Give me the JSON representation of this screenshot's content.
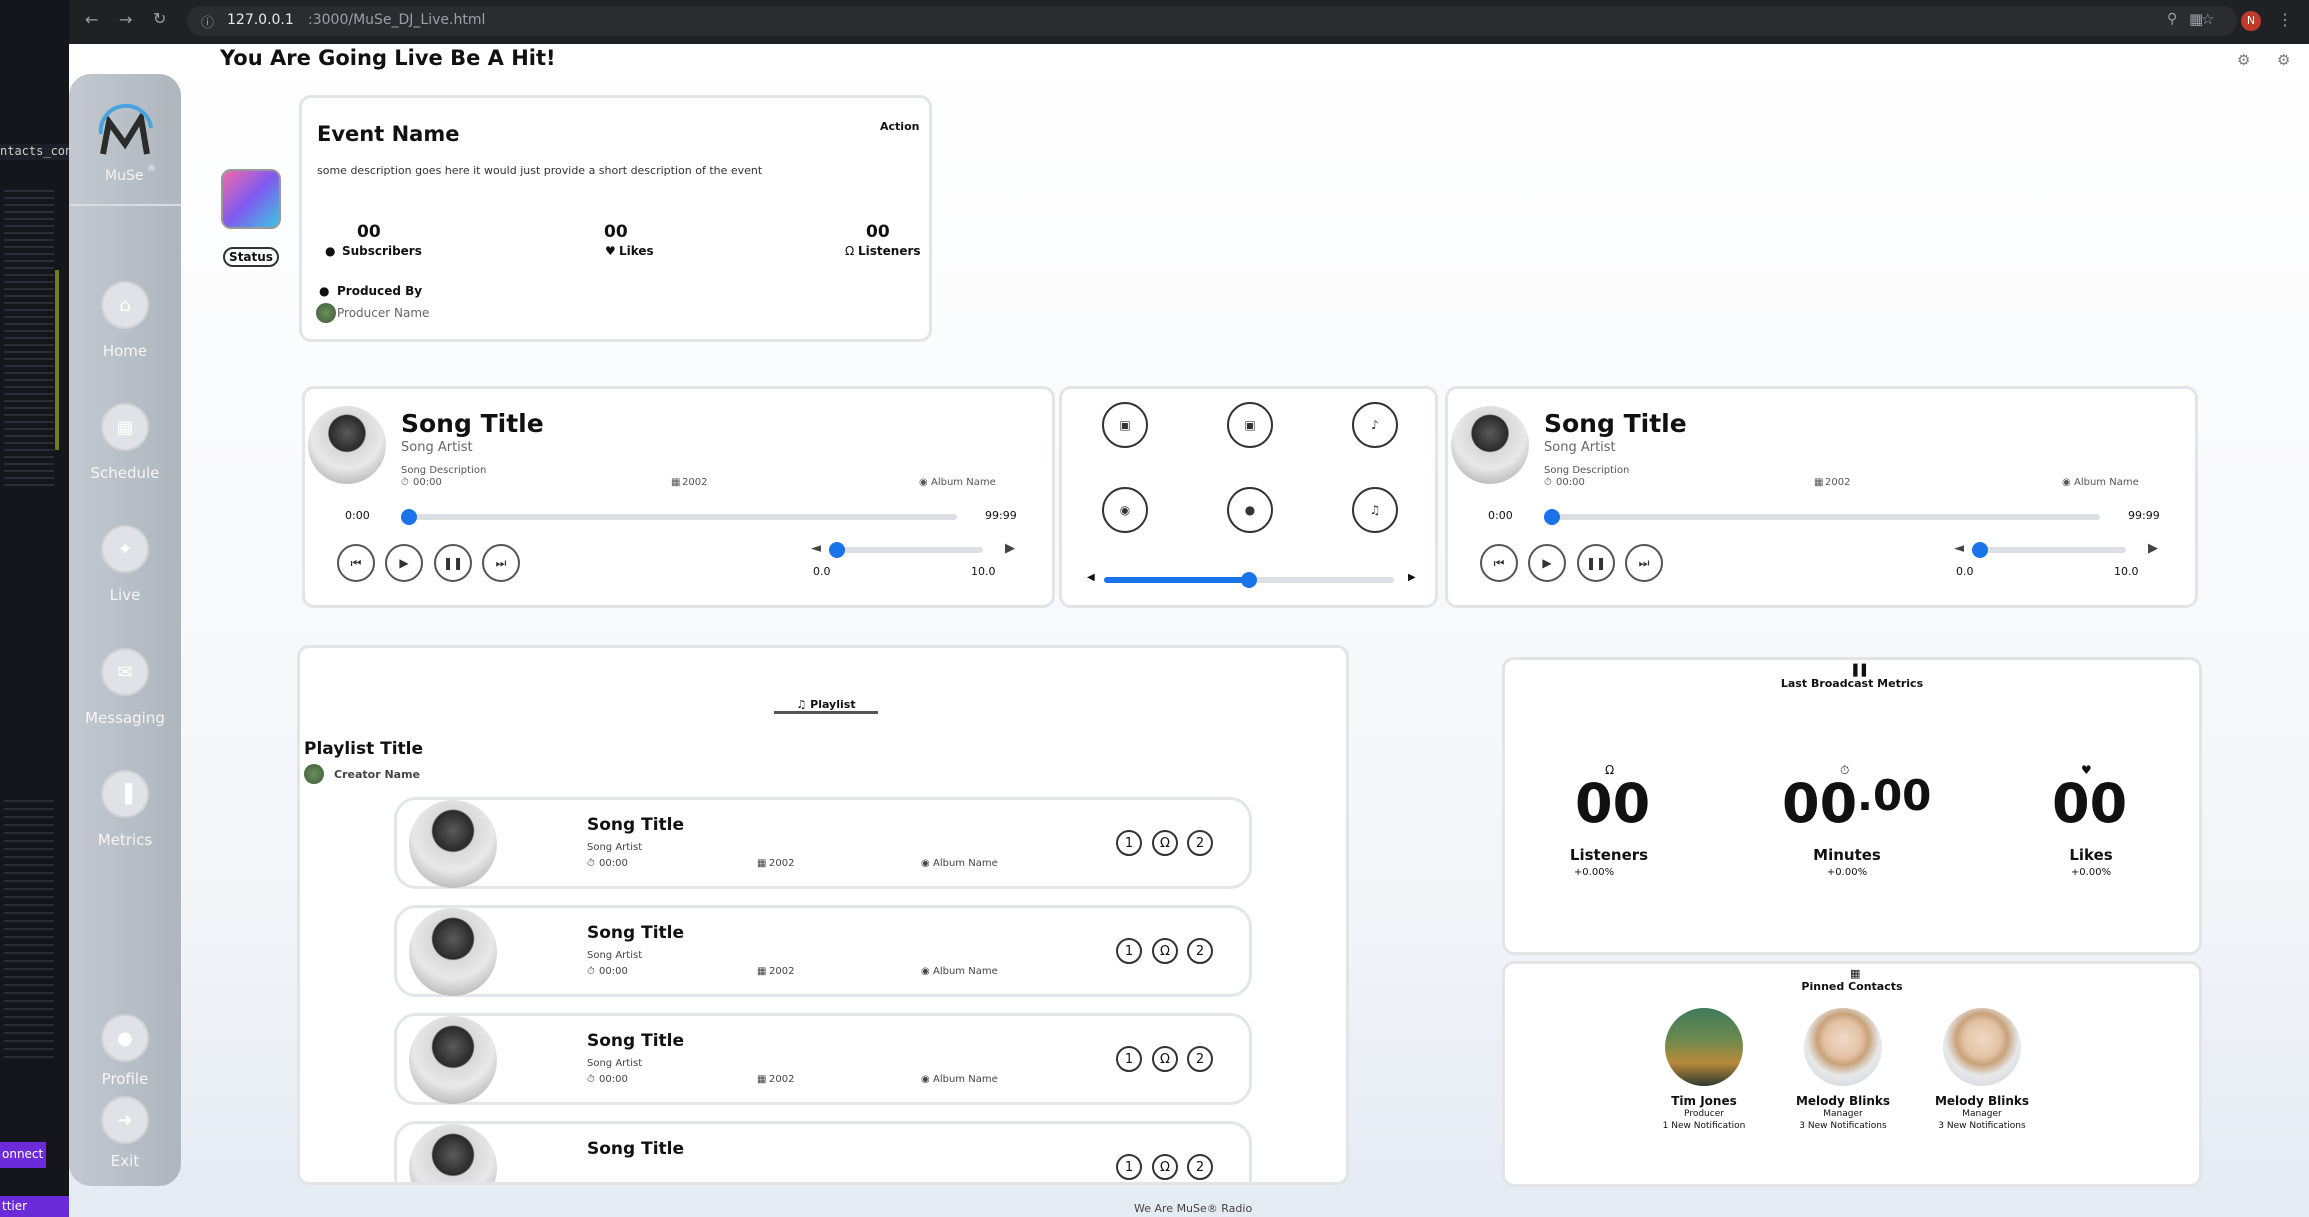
{
  "browser": {
    "url_host": "127.0.0.1",
    "url_path": ":3000/MuSe_DJ_Live.html",
    "profile_initial": "N"
  },
  "left_strip": {
    "file_label": "ntacts_con",
    "connect_label": "onnect",
    "bottom_label": "ttier"
  },
  "colors": {
    "accent": "#1a73e8",
    "sidebar": "#b9c0c8",
    "connect": "#6c2bd9"
  },
  "sidebar": {
    "logo_text": "MuSe",
    "logo_mark": "®",
    "items": [
      {
        "label": "Home",
        "icon": "home-icon"
      },
      {
        "label": "Schedule",
        "icon": "calendar-icon"
      },
      {
        "label": "Live",
        "icon": "broadcast-icon"
      },
      {
        "label": "Messaging",
        "icon": "inbox-icon"
      },
      {
        "label": "Metrics",
        "icon": "bar-chart-icon"
      }
    ],
    "profile_label": "Profile",
    "exit_label": "Exit"
  },
  "header": {
    "title": "You Are Going Live Be A Hit!"
  },
  "event": {
    "name": "Event Name",
    "action": "Action",
    "description": "some description goes here it would just provide a short description of the event",
    "status": "Status",
    "stats": [
      {
        "value": "00",
        "label": "Subscribers",
        "icon": "users-icon"
      },
      {
        "value": "00",
        "label": "Likes",
        "icon": "heart-icon"
      },
      {
        "value": "00",
        "label": "Listeners",
        "icon": "headphones-icon"
      }
    ],
    "produced_by": "Produced By",
    "producer": "Producer Name"
  },
  "players": [
    {
      "title": "Song Title",
      "artist": "Song Artist",
      "description": "Song Description",
      "duration": "00:00",
      "year": "2002",
      "album": "Album Name",
      "time_start": "0:00",
      "time_end": "99:99",
      "progress": 0,
      "vol_min": "0.0",
      "vol_max": "10.0",
      "volume": 0
    },
    {
      "title": "Song Title",
      "artist": "Song Artist",
      "description": "Song Description",
      "duration": "00:00",
      "year": "2002",
      "album": "Album Name",
      "time_start": "0:00",
      "time_end": "99:99",
      "progress": 0,
      "vol_min": "0.0",
      "vol_max": "10.0",
      "volume": 0
    }
  ],
  "mixer": {
    "pads": [
      "drum-icon",
      "drum-icon",
      "guitar-icon",
      "cymbal-icon",
      "record-icon",
      "microphone-icon"
    ],
    "crossfader": 0.5
  },
  "playlist": {
    "tab_label": "Playlist",
    "title": "Playlist Title",
    "creator": "Creator Name",
    "songs": [
      {
        "title": "Song Title",
        "artist": "Song Artist",
        "duration": "00:00",
        "year": "2002",
        "album": "Album Name"
      },
      {
        "title": "Song Title",
        "artist": "Song Artist",
        "duration": "00:00",
        "year": "2002",
        "album": "Album Name"
      },
      {
        "title": "Song Title",
        "artist": "Song Artist",
        "duration": "00:00",
        "year": "2002",
        "album": "Album Name"
      },
      {
        "title": "Song Title",
        "artist": "",
        "duration": "",
        "year": "",
        "album": ""
      }
    ],
    "row_buttons": [
      "1",
      "2"
    ]
  },
  "metrics": {
    "title": "Last Broadcast Metrics",
    "items": [
      {
        "value": "00",
        "label": "Listeners",
        "change": "+0.00%",
        "icon": "headphones-icon"
      },
      {
        "value": "00",
        "value_sup": ".00",
        "label": "Minutes",
        "change": "+0.00%",
        "icon": "stopwatch-icon"
      },
      {
        "value": "00",
        "label": "Likes",
        "change": "+0.00%",
        "icon": "heart-icon"
      }
    ]
  },
  "contacts": {
    "title": "Pinned Contacts",
    "items": [
      {
        "name": "Tim Jones",
        "role": "Producer",
        "notes": "1 New Notification"
      },
      {
        "name": "Melody Blinks",
        "role": "Manager",
        "notes": "3 New Notifications"
      },
      {
        "name": "Melody Blinks",
        "role": "Manager",
        "notes": "3 New Notifications"
      }
    ]
  },
  "footer": {
    "text": "We Are MuSe® Radio"
  }
}
